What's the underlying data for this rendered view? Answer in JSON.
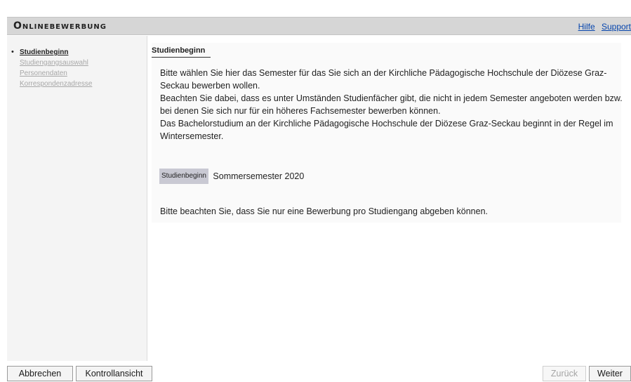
{
  "header": {
    "title": "Onlinebewerbung",
    "help_link": "Hilfe",
    "support_link": "Support"
  },
  "sidebar": {
    "items": [
      {
        "label": "Studienbeginn",
        "active": true
      },
      {
        "label": "Studiengangsauswahl",
        "active": false
      },
      {
        "label": "Personendaten",
        "active": false
      },
      {
        "label": "Korrespondenzadresse",
        "active": false
      }
    ]
  },
  "main": {
    "section_tab": "Studienbeginn",
    "intro_lines": [
      "Bitte wählen Sie hier das Semester für das Sie sich an der Kirchliche Pädagogische Hochschule der Diözese Graz-Seckau bewerben wollen.",
      "Beachten Sie dabei, dass es unter Umständen Studienfächer gibt, die nicht in jedem Semester angeboten werden bzw. bei denen Sie sich nur für ein höheres Fachsemester bewerben können.",
      "Das Bachelorstudium an der Kirchliche Pädagogische Hochschule der Diözese Graz-Seckau beginnt in der Regel im Wintersemester."
    ],
    "field_label": "Studienbeginn",
    "field_value": "Sommersemester 2020",
    "notice": "Bitte beachten Sie, dass Sie nur eine Bewerbung pro Studiengang abgeben können."
  },
  "footer": {
    "cancel_label": "Abbrechen",
    "review_label": "Kontrollansicht",
    "back_label": "Zurück",
    "back_disabled": true,
    "next_label": "Weiter"
  },
  "colors": {
    "header_bg": "#d6d6d6",
    "link": "#0645ad",
    "sidebar_bg": "#f4f4f4",
    "field_label_bg": "#c9c9d3"
  }
}
